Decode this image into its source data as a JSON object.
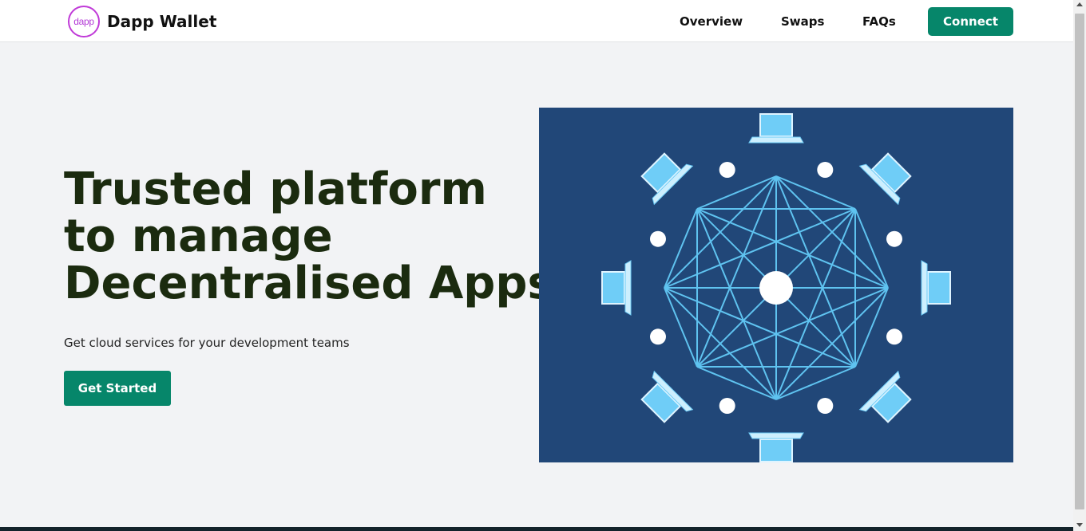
{
  "header": {
    "logo_text": "dapp",
    "brand": "Dapp Wallet",
    "nav": [
      {
        "label": "Overview"
      },
      {
        "label": "Swaps"
      },
      {
        "label": "FAQs"
      }
    ],
    "connect_label": "Connect"
  },
  "hero": {
    "title_lines": [
      "Trusted platform",
      "to manage",
      "Decentralised Apps"
    ],
    "subtitle": "Get cloud services for your development teams",
    "cta_label": "Get Started"
  },
  "illustration": {
    "description_icon": "network-mesh-illustration",
    "colors": {
      "background": "#214778",
      "lines": "#5fc3f0",
      "nodes": "#ffffff",
      "laptops": "#6fcdf7"
    }
  },
  "colors": {
    "accent": "#06866a",
    "page_bg": "#f2f3f5",
    "title": "#1b2b0f"
  }
}
